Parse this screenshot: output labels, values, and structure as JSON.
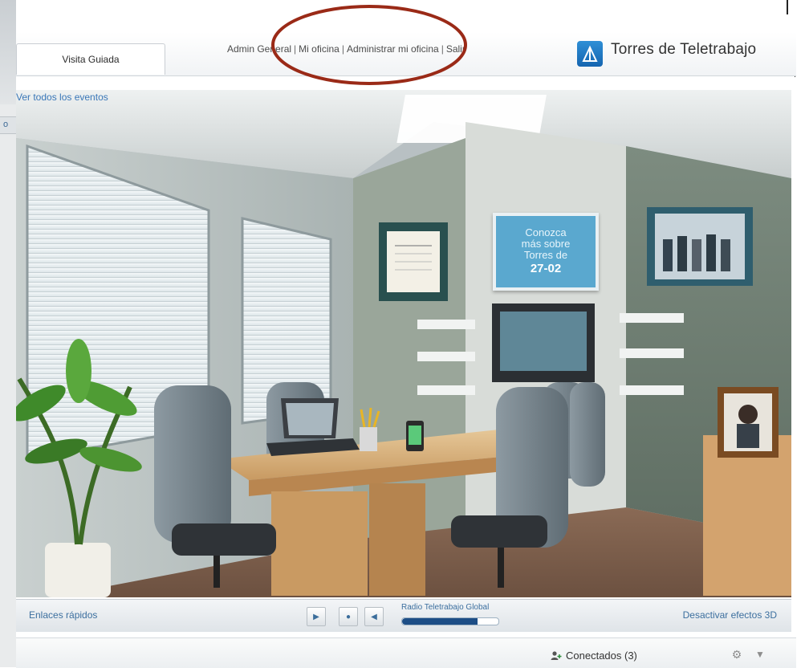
{
  "left_fragment": {
    "text": "o"
  },
  "header": {
    "tab_label": "Visita Guiada",
    "nav": {
      "admin_general": "Admin General",
      "mi_oficina": "Mi oficina",
      "administrar": "Administrar mi oficina",
      "salir": "Salir",
      "separator": "|"
    },
    "brand_title": "Torres de Teletrabajo"
  },
  "office": {
    "ver_todos_link": "Ver todos los eventos",
    "info_board": {
      "line1": "Conozca",
      "line2": "más sobre",
      "line3": "Torres de",
      "date": "27-02"
    }
  },
  "toolbar": {
    "quick_links": "Enlaces rápidos",
    "radio_label": "Radio Teletrabajo Global",
    "radio_progress": 0.78,
    "disable_3d": "Desactivar efectos 3D"
  },
  "status": {
    "connected_label": "Conectados (3)"
  },
  "colors": {
    "link_blue": "#3c6f9f",
    "brand_blue": "#1f78c8",
    "annotation_red": "#9a2a17",
    "board_blue": "#5aa8cf"
  },
  "icons": [
    "play-icon",
    "stop-icon",
    "previous-icon",
    "add-user-icon",
    "settings-icon",
    "minimize-icon",
    "brand-logo-icon"
  ]
}
